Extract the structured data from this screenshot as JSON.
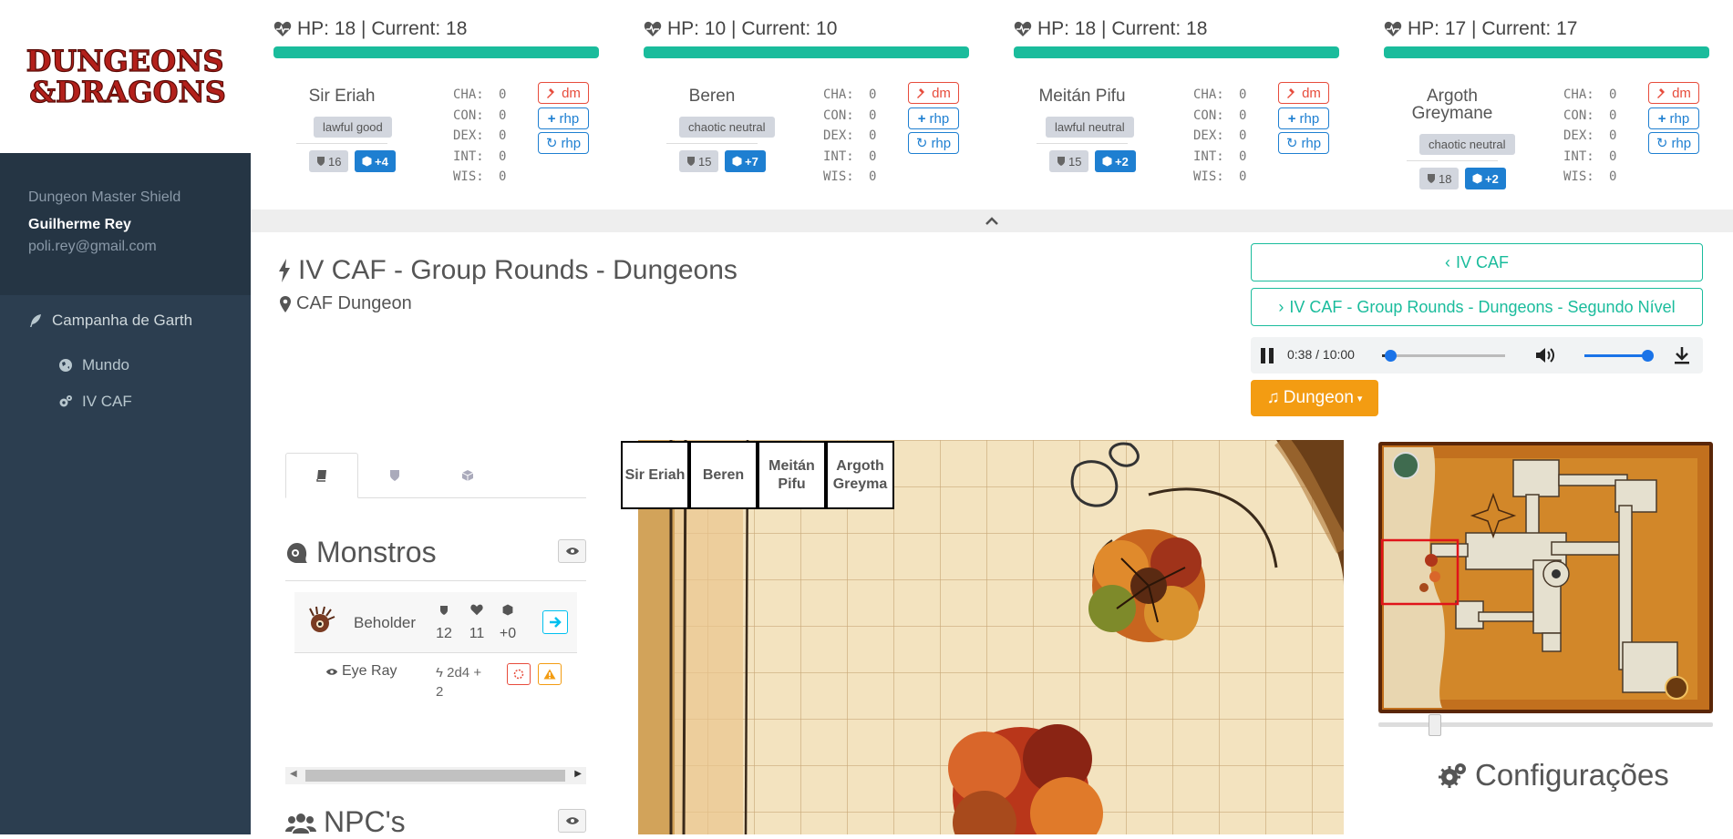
{
  "sidebar": {
    "role": "Dungeon Master Shield",
    "user_name": "Guilherme Rey",
    "user_email": "poli.rey@gmail.com",
    "campaign": "Campanha de Garth",
    "items": [
      {
        "label": "Mundo",
        "icon": "globe-icon"
      },
      {
        "label": "IV CAF",
        "icon": "gears-icon"
      }
    ]
  },
  "logo_text": [
    "DUNGEONS",
    "&DRAGONS"
  ],
  "colors": {
    "sidebar": "#2c3e50",
    "accent_teal": "#1abc9c",
    "accent_blue": "#1e7fd1",
    "danger": "#e74c3c",
    "warning": "#f39c12"
  },
  "players": [
    {
      "hp": "HP: 18 | Current: 18",
      "name": "Sir Eriah",
      "alignment": "lawful good",
      "ac": "16",
      "init": "+4",
      "stats": [
        [
          "CHA:",
          "0"
        ],
        [
          "CON:",
          "0"
        ],
        [
          "DEX:",
          "0"
        ],
        [
          "INT:",
          "0"
        ],
        [
          "WIS:",
          "0"
        ]
      ]
    },
    {
      "hp": "HP: 10 | Current: 10",
      "name": "Beren",
      "alignment": "chaotic neutral",
      "ac": "15",
      "init": "+7",
      "stats": [
        [
          "CHA:",
          "0"
        ],
        [
          "CON:",
          "0"
        ],
        [
          "DEX:",
          "0"
        ],
        [
          "INT:",
          "0"
        ],
        [
          "WIS:",
          "0"
        ]
      ]
    },
    {
      "hp": "HP: 18 | Current: 18",
      "name": "Meitán Pifu",
      "alignment": "lawful neutral",
      "ac": "15",
      "init": "+2",
      "stats": [
        [
          "CHA:",
          "0"
        ],
        [
          "CON:",
          "0"
        ],
        [
          "DEX:",
          "0"
        ],
        [
          "INT:",
          "0"
        ],
        [
          "WIS:",
          "0"
        ]
      ]
    },
    {
      "hp": "HP: 17 | Current: 17",
      "name": "Argoth Greymane",
      "alignment": "chaotic neutral",
      "ac": "18",
      "init": "+2",
      "stats": [
        [
          "CHA:",
          "0"
        ],
        [
          "CON:",
          "0"
        ],
        [
          "DEX:",
          "0"
        ],
        [
          "INT:",
          "0"
        ],
        [
          "WIS:",
          "0"
        ]
      ]
    }
  ],
  "player_buttons": {
    "dm": "dm",
    "rhp_add": "rhp",
    "rhp_reset": "rhp"
  },
  "scene": {
    "title": "IV CAF - Group Rounds - Dungeons",
    "location": "CAF Dungeon",
    "prev_label": "IV CAF",
    "next_label": "IV CAF - Group Rounds - Dungeons - Segundo Nível",
    "audio_time": "0:38 / 10:00",
    "audio_progress": 0.063,
    "audio_volume": 1.0,
    "music_label": "Dungeon"
  },
  "panel": {
    "tabs": [
      "book-icon",
      "shield-icon",
      "cube-icon"
    ],
    "monsters_title": "Monstros",
    "monster": {
      "name": "Beholder",
      "ac": "12",
      "hp": "11",
      "init": "+0"
    },
    "attack": {
      "name": "Eye Ray",
      "damage": "2d4 + 2"
    },
    "npcs_title": "NPC's"
  },
  "tokens": [
    "Sir Eriah",
    "Beren",
    "Meitán Pifu",
    "Argoth Greyma"
  ],
  "config_title": "Configurações"
}
